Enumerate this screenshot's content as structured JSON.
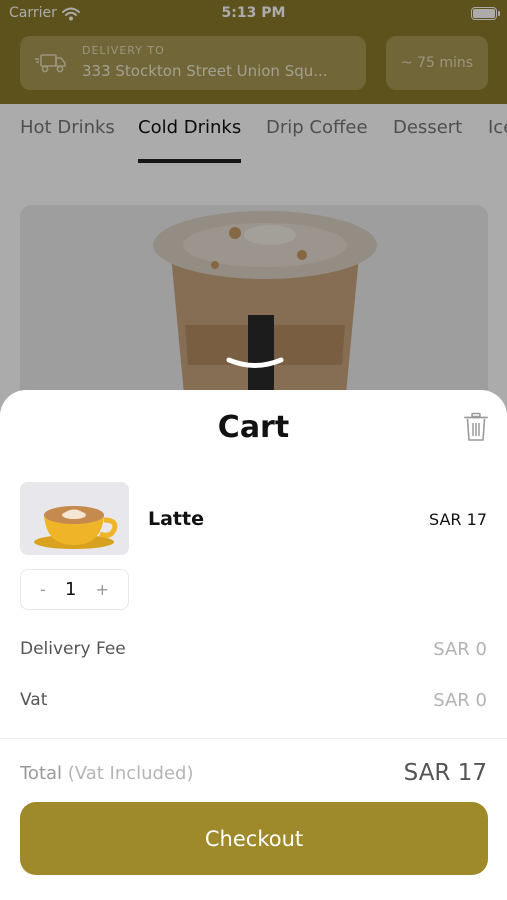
{
  "status_bar": {
    "carrier": "Carrier",
    "time": "5:13 PM"
  },
  "header": {
    "delivery_label": "DELIVERY TO",
    "delivery_address": "333 Stockton Street Union Squ...",
    "eta": "~ 75 mins"
  },
  "tabs": [
    {
      "label": "Hot Drinks",
      "active": false
    },
    {
      "label": "Cold Drinks",
      "active": true
    },
    {
      "label": "Drip Coffee",
      "active": false
    },
    {
      "label": "Dessert",
      "active": false
    },
    {
      "label": "Ice",
      "active": false
    }
  ],
  "cart": {
    "title": "Cart",
    "items": [
      {
        "name": "Latte",
        "price": "SAR 17",
        "quantity": "1",
        "decrement": "-",
        "increment": "+"
      }
    ],
    "delivery_fee_label": "Delivery Fee",
    "delivery_fee_value": "SAR 0",
    "vat_label": "Vat",
    "vat_value": "SAR 0",
    "total_label": "Total",
    "total_sublabel": "(Vat Included)",
    "total_value": "SAR 17",
    "checkout_label": "Checkout"
  },
  "colors": {
    "brand": "#8b7a2a",
    "checkout": "#9e8a2b"
  },
  "icons": [
    "wifi-icon",
    "battery-icon",
    "delivery-truck-icon",
    "trash-icon",
    "chevron-down-icon"
  ]
}
